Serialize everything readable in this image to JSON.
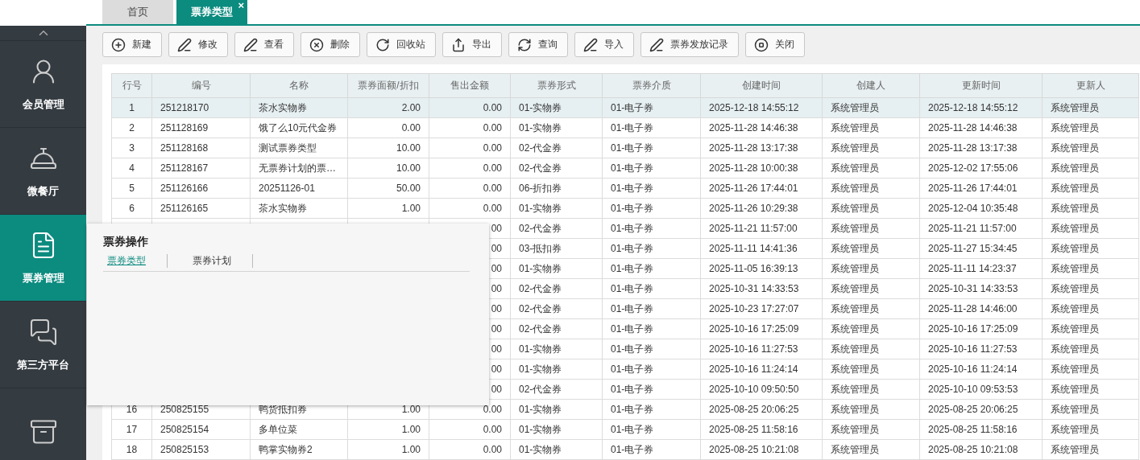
{
  "tabs": [
    {
      "label": "首页",
      "selected": false
    },
    {
      "label": "票券类型",
      "selected": true,
      "close": "×"
    }
  ],
  "sidebar": {
    "items": [
      {
        "label": "会员管理",
        "selected": false
      },
      {
        "label": "微餐厅",
        "selected": false
      },
      {
        "label": "票券管理",
        "selected": true
      },
      {
        "label": "第三方平台",
        "selected": false
      },
      {
        "selected": false
      }
    ]
  },
  "toolbar": [
    "新建",
    "修改",
    "查看",
    "删除",
    "回收站",
    "导出",
    "查询",
    "导入",
    "票券发放记录",
    "关闭"
  ],
  "table": {
    "columns": [
      "行号",
      "编号",
      "名称",
      "票券面额/折扣",
      "售出金额",
      "票券形式",
      "票券介质",
      "创建时间",
      "创建人",
      "更新时间",
      "更新人"
    ],
    "rows": [
      {
        "selected": true,
        "cells": [
          "1",
          "251218170",
          "茶水实物券",
          "2.00",
          "0.00",
          "01-实物券",
          "01-电子券",
          "2025-12-18 14:55:12",
          "系统管理员",
          "2025-12-18 14:55:12",
          "系统管理员"
        ]
      },
      {
        "selected": false,
        "cells": [
          "2",
          "251128169",
          "饿了么10元代金券",
          "0.00",
          "0.00",
          "01-实物券",
          "01-电子券",
          "2025-11-28 14:46:38",
          "系统管理员",
          "2025-11-28 14:46:38",
          "系统管理员"
        ]
      },
      {
        "selected": false,
        "cells": [
          "3",
          "251128168",
          "测试票券类型",
          "10.00",
          "0.00",
          "02-代金券",
          "01-电子券",
          "2025-11-28 13:17:38",
          "系统管理员",
          "2025-11-28 13:17:38",
          "系统管理员"
        ]
      },
      {
        "selected": false,
        "cells": [
          "4",
          "251128167",
          "无票券计划的票…",
          "10.00",
          "0.00",
          "02-代金券",
          "01-电子券",
          "2025-11-28 10:00:38",
          "系统管理员",
          "2025-12-02 17:55:06",
          "系统管理员"
        ]
      },
      {
        "selected": false,
        "cells": [
          "5",
          "251126166",
          "20251126-01",
          "50.00",
          "0.00",
          "06-折扣券",
          "01-电子券",
          "2025-11-26 17:44:01",
          "系统管理员",
          "2025-11-26 17:44:01",
          "系统管理员"
        ]
      },
      {
        "selected": false,
        "cells": [
          "6",
          "251126165",
          "茶水实物券",
          "1.00",
          "0.00",
          "01-实物券",
          "01-电子券",
          "2025-11-26 10:29:38",
          "系统管理员",
          "2025-12-04 10:35:48",
          "系统管理员"
        ]
      },
      {
        "selected": false,
        "cells": [
          null,
          null,
          null,
          null,
          "00",
          "02-代金券",
          "01-电子券",
          "2025-11-21 11:57:00",
          "系统管理员",
          "2025-11-21 11:57:00",
          "系统管理员"
        ]
      },
      {
        "selected": false,
        "cells": [
          null,
          null,
          null,
          null,
          "00",
          "03-抵扣券",
          "01-电子券",
          "2025-11-11 14:41:36",
          "系统管理员",
          "2025-11-27 15:34:45",
          "系统管理员"
        ]
      },
      {
        "selected": false,
        "cells": [
          null,
          null,
          null,
          null,
          "00",
          "01-实物券",
          "01-电子券",
          "2025-11-05 16:39:13",
          "系统管理员",
          "2025-11-11 14:23:37",
          "系统管理员"
        ]
      },
      {
        "selected": false,
        "cells": [
          null,
          null,
          null,
          null,
          "00",
          "02-代金券",
          "01-电子券",
          "2025-10-31 14:33:53",
          "系统管理员",
          "2025-10-31 14:33:53",
          "系统管理员"
        ]
      },
      {
        "selected": false,
        "cells": [
          null,
          null,
          null,
          null,
          "00",
          "02-代金券",
          "01-电子券",
          "2025-10-23 17:27:07",
          "系统管理员",
          "2025-11-28 14:46:00",
          "系统管理员"
        ]
      },
      {
        "selected": false,
        "cells": [
          null,
          null,
          null,
          null,
          "00",
          "02-代金券",
          "01-电子券",
          "2025-10-16 17:25:09",
          "系统管理员",
          "2025-10-16 17:25:09",
          "系统管理员"
        ]
      },
      {
        "selected": false,
        "cells": [
          null,
          null,
          null,
          null,
          "00",
          "01-实物券",
          "01-电子券",
          "2025-10-16 11:27:53",
          "系统管理员",
          "2025-10-16 11:27:53",
          "系统管理员"
        ]
      },
      {
        "selected": false,
        "cells": [
          null,
          null,
          null,
          null,
          "00",
          "01-实物券",
          "01-电子券",
          "2025-10-16 11:24:14",
          "系统管理员",
          "2025-10-16 11:24:14",
          "系统管理员"
        ]
      },
      {
        "selected": false,
        "cells": [
          null,
          null,
          null,
          null,
          "00",
          "02-代金券",
          "01-电子券",
          "2025-10-10 09:50:50",
          "系统管理员",
          "2025-10-10 09:53:53",
          "系统管理员"
        ]
      },
      {
        "selected": false,
        "cells": [
          "16",
          "250825155",
          "鸭货抵扣券",
          "1.00",
          "0.00",
          "01-实物券",
          "01-电子券",
          "2025-08-25 20:06:25",
          "系统管理员",
          "2025-08-25 20:06:25",
          "系统管理员"
        ]
      },
      {
        "selected": false,
        "cells": [
          "17",
          "250825154",
          "多单位菜",
          "1.00",
          "0.00",
          "01-实物券",
          "01-电子券",
          "2025-08-25 11:58:16",
          "系统管理员",
          "2025-08-25 11:58:16",
          "系统管理员"
        ]
      },
      {
        "selected": false,
        "cells": [
          "18",
          "250825153",
          "鸭掌实物券2",
          "1.00",
          "0.00",
          "01-实物券",
          "01-电子券",
          "2025-08-25 10:21:08",
          "系统管理员",
          "2025-08-25 10:21:08",
          "系统管理员"
        ]
      }
    ]
  },
  "popup": {
    "title": "票券操作",
    "links": [
      {
        "label": "票券类型",
        "selected": true
      },
      {
        "label": "票券计划",
        "selected": false
      }
    ]
  }
}
